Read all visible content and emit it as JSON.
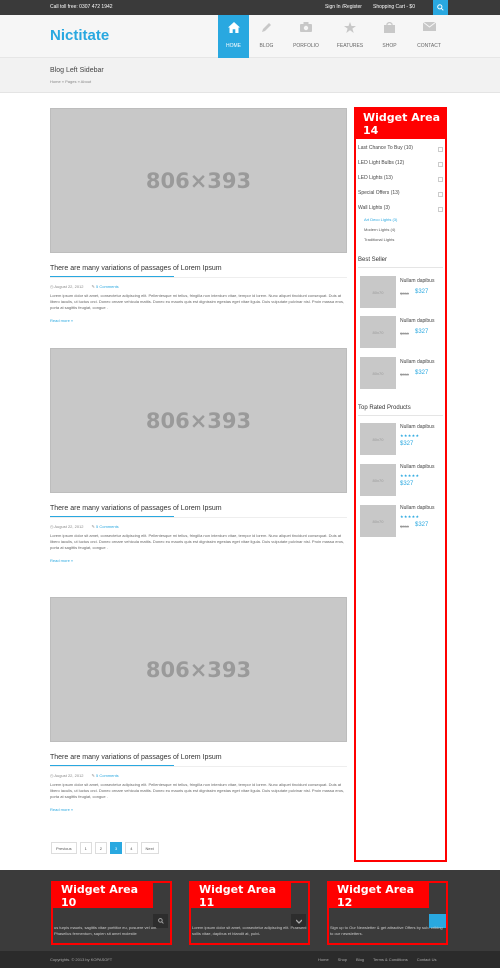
{
  "topbar": {
    "call": "Call toll free: 0307 472 1942",
    "signin": "Sign In /Register",
    "cart": "Shopping Cart - $0"
  },
  "header": {
    "logo": "Nictitate",
    "nav": [
      {
        "label": "HOME",
        "icon": "home-icon"
      },
      {
        "label": "BLOG",
        "icon": "pencil-icon"
      },
      {
        "label": "PORFOLIO",
        "icon": "camera-icon"
      },
      {
        "label": "FEATURES",
        "icon": "star-icon"
      },
      {
        "label": "SHOP",
        "icon": "bag-icon"
      },
      {
        "label": "CONTACT",
        "icon": "mail-icon"
      }
    ]
  },
  "page": {
    "title": "Blog Left Sidebar",
    "breadcrumb": "Home  »  Pages  »  About"
  },
  "posts": [
    {
      "image": "806×393",
      "title": "There are many variations of passages of Lorem Ipsum",
      "date": "August 22, 2012",
      "comments": "5 Comments",
      "excerpt": "Lorem ipsum dolor sit amet, consectetur adipiscing elit. Pellentesque mi tellus, fringilla non interdum vitae, tempor id lorem. Nunc aliquet tincidunt consequat. Duis at libero iaculis, ut luctus orci. Donec ornare vehicula mattis. Donec eu mauris quis est dignissim egestas eget vitae ligula. Duis vulputate pulvinar nisl. Proin massa eros, porta at sagittis feugiat, congue .",
      "readmore": "Read more »"
    },
    {
      "image": "806×393",
      "title": "There are many variations of passages of Lorem Ipsum",
      "date": "August 22, 2012",
      "comments": "5 Comments",
      "excerpt": "Lorem ipsum dolor sit amet, consectetur adipiscing elit. Pellentesque mi tellus, fringilla non interdum vitae, tempor id lorem. Nunc aliquet tincidunt consequat. Duis at libero iaculis, ut luctus orci. Donec ornare vehicula mattis. Donec eu mauris quis est dignissim egestas eget vitae ligula. Duis vulputate pulvinar nisl. Proin massa eros, porta at sagittis feugiat, congue .",
      "readmore": "Read more »"
    },
    {
      "image": "806×393",
      "title": "There are many variations of passages of Lorem Ipsum",
      "date": "August 22, 2012",
      "comments": "5 Comments",
      "excerpt": "Lorem ipsum dolor sit amet, consectetur adipiscing elit. Pellentesque mi tellus, fringilla non interdum vitae, tempor id lorem. Nunc aliquet tincidunt consequat. Duis at libero iaculis, ut luctus orci. Donec ornare vehicula mattis. Donec eu mauris quis est dignissim egestas eget vitae ligula. Duis vulputate pulvinar nisl. Proin massa eros, porta at sagittis feugiat, congue .",
      "readmore": "Read more »"
    }
  ],
  "pagination": {
    "prev": "Previous",
    "pages": [
      "1",
      "2",
      "3",
      "4"
    ],
    "active": "3",
    "next": "Next"
  },
  "sidebar": {
    "widget_title": "Widget Area 14",
    "categories": [
      "Last Chance To Buy (10)",
      "LED Light Bulbs (12)",
      "LED Lights (13)",
      "Special Offers (13)",
      "Wall Lights (3)"
    ],
    "subcategories": [
      "Art Deco Lights (3)",
      "Modern Lights (4)",
      "Traditional Lights"
    ],
    "best_seller_title": "Best Seller",
    "best_sellers": [
      {
        "thumb": "80x70",
        "name": "Nullam dapibus",
        "old": "$350",
        "price": "$327"
      },
      {
        "thumb": "80x70",
        "name": "Nullam dapibus",
        "old": "$350",
        "price": "$327"
      },
      {
        "thumb": "80x70",
        "name": "Nullam dapibus",
        "old": "$350",
        "price": "$327"
      }
    ],
    "top_rated_title": "Top Rated Products",
    "top_rated": [
      {
        "thumb": "80x70",
        "name": "Nullam dapibus",
        "stars": "★★★★★",
        "price": "$327"
      },
      {
        "thumb": "80x70",
        "name": "Nullam dapibus",
        "stars": "★★★★★",
        "price": "$327"
      },
      {
        "thumb": "80x70",
        "name": "Nullam dapibus",
        "stars": "★★★★★",
        "old": "$350",
        "price": "$327"
      }
    ]
  },
  "footer": {
    "widgets": [
      {
        "title": "Widget Area 10",
        "text": "us turpis mauris, sagittis vitae porttitor eu, posuere vel um. Phasellus fermentum, sapien sit amet molestie"
      },
      {
        "title": "Widget Area 11",
        "text": "Lorem ipsum dolor sit amet, consectetur adipiscing elit. Praesent sollis vitae, dapibus et blandit at, pulvi-"
      },
      {
        "title": "Widget Area 12",
        "text": "Sign up to Our Newsletter & get attractive Offers by sub- cribing to our newsletters."
      }
    ],
    "copyright": "Copyrights. © 2013 by KOPASOFT",
    "links": [
      "Home",
      "Shop",
      "Blog",
      "Terms & Conditions",
      "Contact Us"
    ]
  },
  "colors": {
    "accent": "#29a8e0",
    "widget": "#ff0000",
    "footer_bg": "#3b3b3b"
  }
}
